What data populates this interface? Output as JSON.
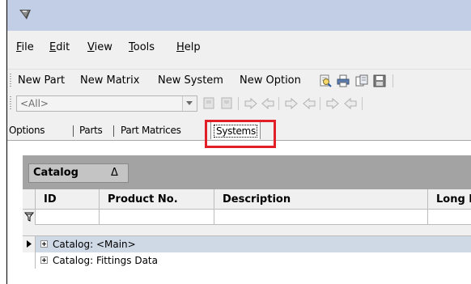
{
  "menu": {
    "file": {
      "u": "F",
      "rest": "ile"
    },
    "edit": {
      "u": "E",
      "rest": "dit"
    },
    "view": {
      "u": "V",
      "rest": "iew"
    },
    "tools": {
      "u": "T",
      "rest": "ools"
    },
    "help": {
      "u": "H",
      "rest": "elp"
    }
  },
  "toolbar": {
    "new_part": "New Part",
    "new_matrix": "New Matrix",
    "new_system": "New System",
    "new_option": "New Option",
    "icons": [
      "print-preview-icon",
      "print-icon",
      "copy-icon",
      "save-icon"
    ]
  },
  "filter_toolbar": {
    "combo_value": "<All>",
    "icons": [
      "disabled-doc-icon",
      "disabled-doc-icon",
      "move-right-icon",
      "move-left-icon",
      "move-right-icon",
      "move-left-icon",
      "move-right-icon",
      "move-left-icon"
    ]
  },
  "tabs": {
    "options": "Options",
    "parts": "Parts",
    "part_matrices": "Part Matrices",
    "systems": "Systems",
    "selected": "Systems"
  },
  "grid": {
    "group_by": "Catalog",
    "group_sort_symbol": "Δ",
    "columns": [
      "ID",
      "Product No.",
      "Description",
      "Long I"
    ],
    "rows": [
      {
        "label": "Catalog:  <Main>",
        "selected": true
      },
      {
        "label": "Catalog: Fittings Data",
        "selected": false
      }
    ]
  },
  "colors": {
    "highlight": "#e21f26",
    "titlebar": "#c2cde6",
    "group_area": "#a3a3a3",
    "selected_row": "#cfd9e6"
  }
}
